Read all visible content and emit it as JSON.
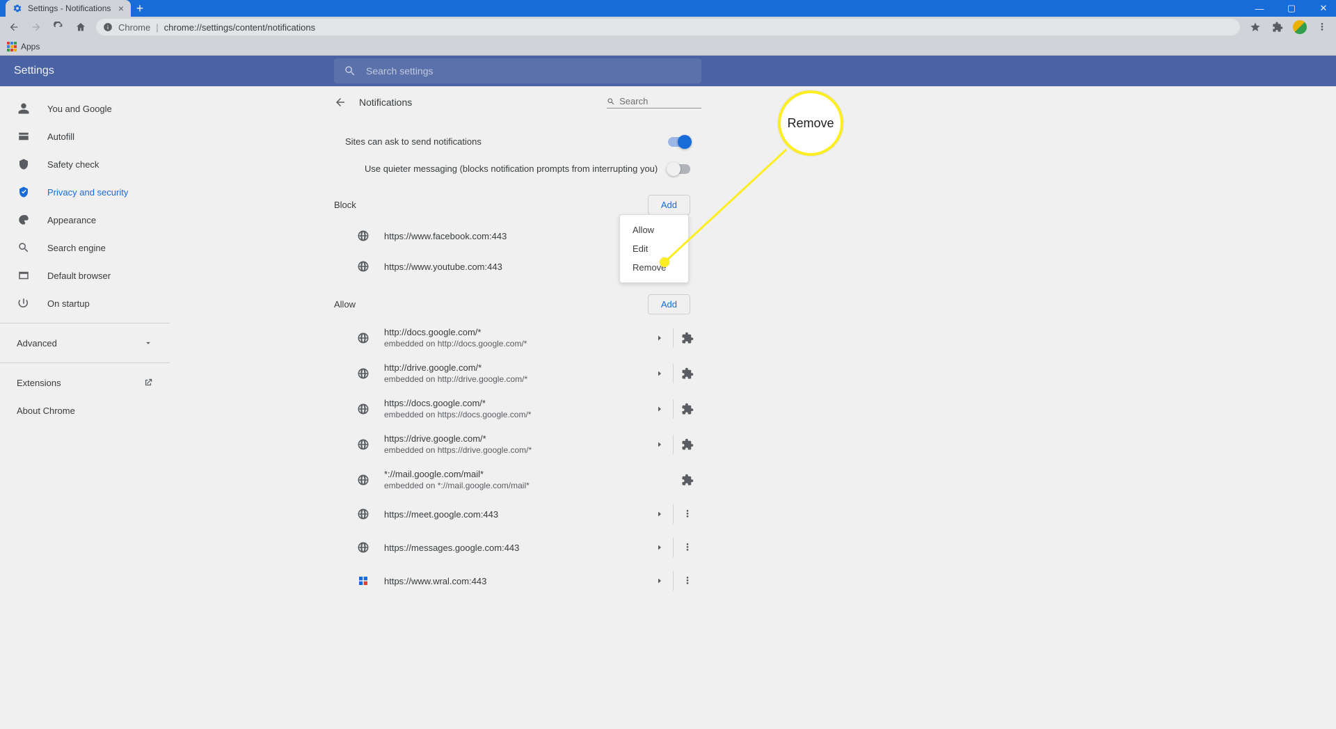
{
  "window": {
    "tab_title": "Settings - Notifications",
    "new_tab_glyph": "+",
    "window_min": "—",
    "window_max": "▢",
    "window_close": "✕"
  },
  "toolbar": {
    "origin_label": "Chrome",
    "url_path": "chrome://settings/content/notifications",
    "apps_label": "Apps"
  },
  "header": {
    "title": "Settings",
    "search_placeholder": "Search settings"
  },
  "sidebar": {
    "items": [
      {
        "label": "You and Google",
        "icon": "person"
      },
      {
        "label": "Autofill",
        "icon": "autofill"
      },
      {
        "label": "Safety check",
        "icon": "shield"
      },
      {
        "label": "Privacy and security",
        "icon": "security",
        "active": true
      },
      {
        "label": "Appearance",
        "icon": "appearance"
      },
      {
        "label": "Search engine",
        "icon": "search"
      },
      {
        "label": "Default browser",
        "icon": "browser"
      },
      {
        "label": "On startup",
        "icon": "startup"
      }
    ],
    "advanced_label": "Advanced",
    "extensions_label": "Extensions",
    "about_label": "About Chrome"
  },
  "panel": {
    "title": "Notifications",
    "search_placeholder": "Search",
    "toggle_main": "Sites can ask to send notifications",
    "toggle_main_on": true,
    "toggle_quiet": "Use quieter messaging (blocks notification prompts from interrupting you)",
    "toggle_quiet_on": false,
    "block_label": "Block",
    "allow_label": "Allow",
    "add_label": "Add",
    "block_sites": [
      {
        "url": "https://www.facebook.com:443"
      },
      {
        "url": "https://www.youtube.com:443"
      }
    ],
    "allow_sites": [
      {
        "url": "http://docs.google.com/*",
        "embed": "embedded on http://docs.google.com/*",
        "ext": true,
        "caret": true
      },
      {
        "url": "http://drive.google.com/*",
        "embed": "embedded on http://drive.google.com/*",
        "ext": true,
        "caret": true
      },
      {
        "url": "https://docs.google.com/*",
        "embed": "embedded on https://docs.google.com/*",
        "ext": true,
        "caret": true
      },
      {
        "url": "https://drive.google.com/*",
        "embed": "embedded on https://drive.google.com/*",
        "ext": true,
        "caret": true
      },
      {
        "url": "*://mail.google.com/mail*",
        "embed": "embedded on *://mail.google.com/mail*",
        "ext": true,
        "caret": false
      },
      {
        "url": "https://meet.google.com:443",
        "menu": true,
        "caret": true
      },
      {
        "url": "https://messages.google.com:443",
        "menu": true,
        "caret": true
      },
      {
        "url": "https://www.wral.com:443",
        "menu": true,
        "caret": true,
        "special_icon": true
      }
    ]
  },
  "context_menu": {
    "items": [
      "Allow",
      "Edit",
      "Remove"
    ]
  },
  "callout": {
    "text": "Remove"
  }
}
